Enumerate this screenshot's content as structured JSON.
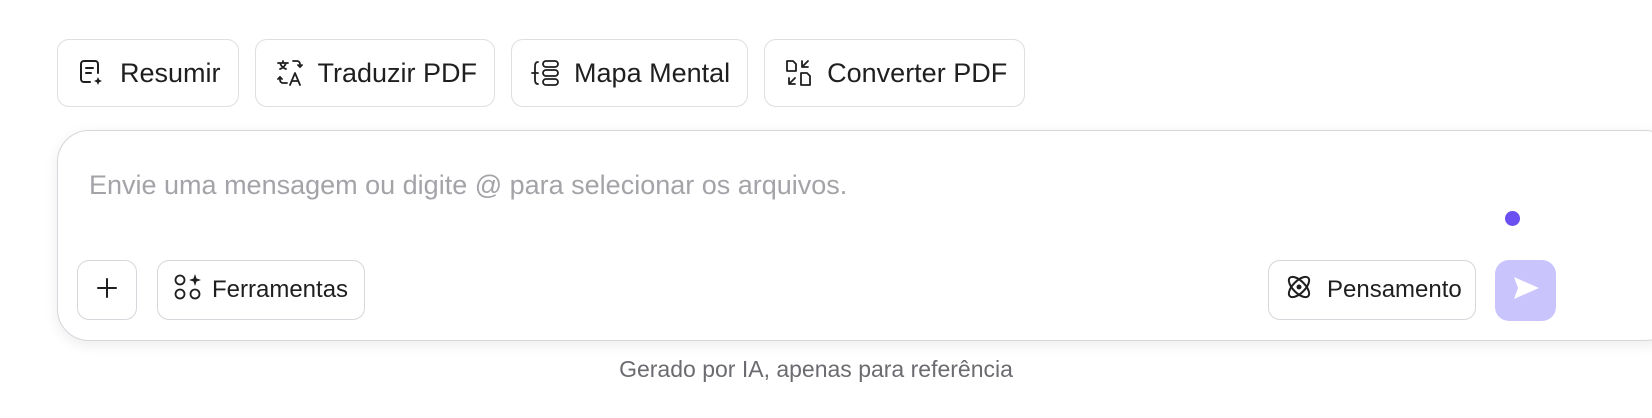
{
  "quick_actions": [
    {
      "label": "Resumir",
      "icon": "summarize-icon"
    },
    {
      "label": "Traduzir PDF",
      "icon": "translate-icon"
    },
    {
      "label": "Mapa Mental",
      "icon": "mind-map-icon"
    },
    {
      "label": "Converter PDF",
      "icon": "convert-icon"
    }
  ],
  "composer": {
    "placeholder": "Envie uma mensagem ou digite @ para selecionar os arquivos.",
    "value": "",
    "add_icon": "plus-icon",
    "tools_label": "Ferramentas",
    "tools_icon": "tools-icon",
    "thinking_label": "Pensamento",
    "thinking_icon": "atom-icon",
    "send_icon": "send-icon",
    "status_dot_color": "#6b4ff0",
    "send_color": "#c9c4fb"
  },
  "footer": {
    "note": "Gerado por IA, apenas para referência"
  }
}
